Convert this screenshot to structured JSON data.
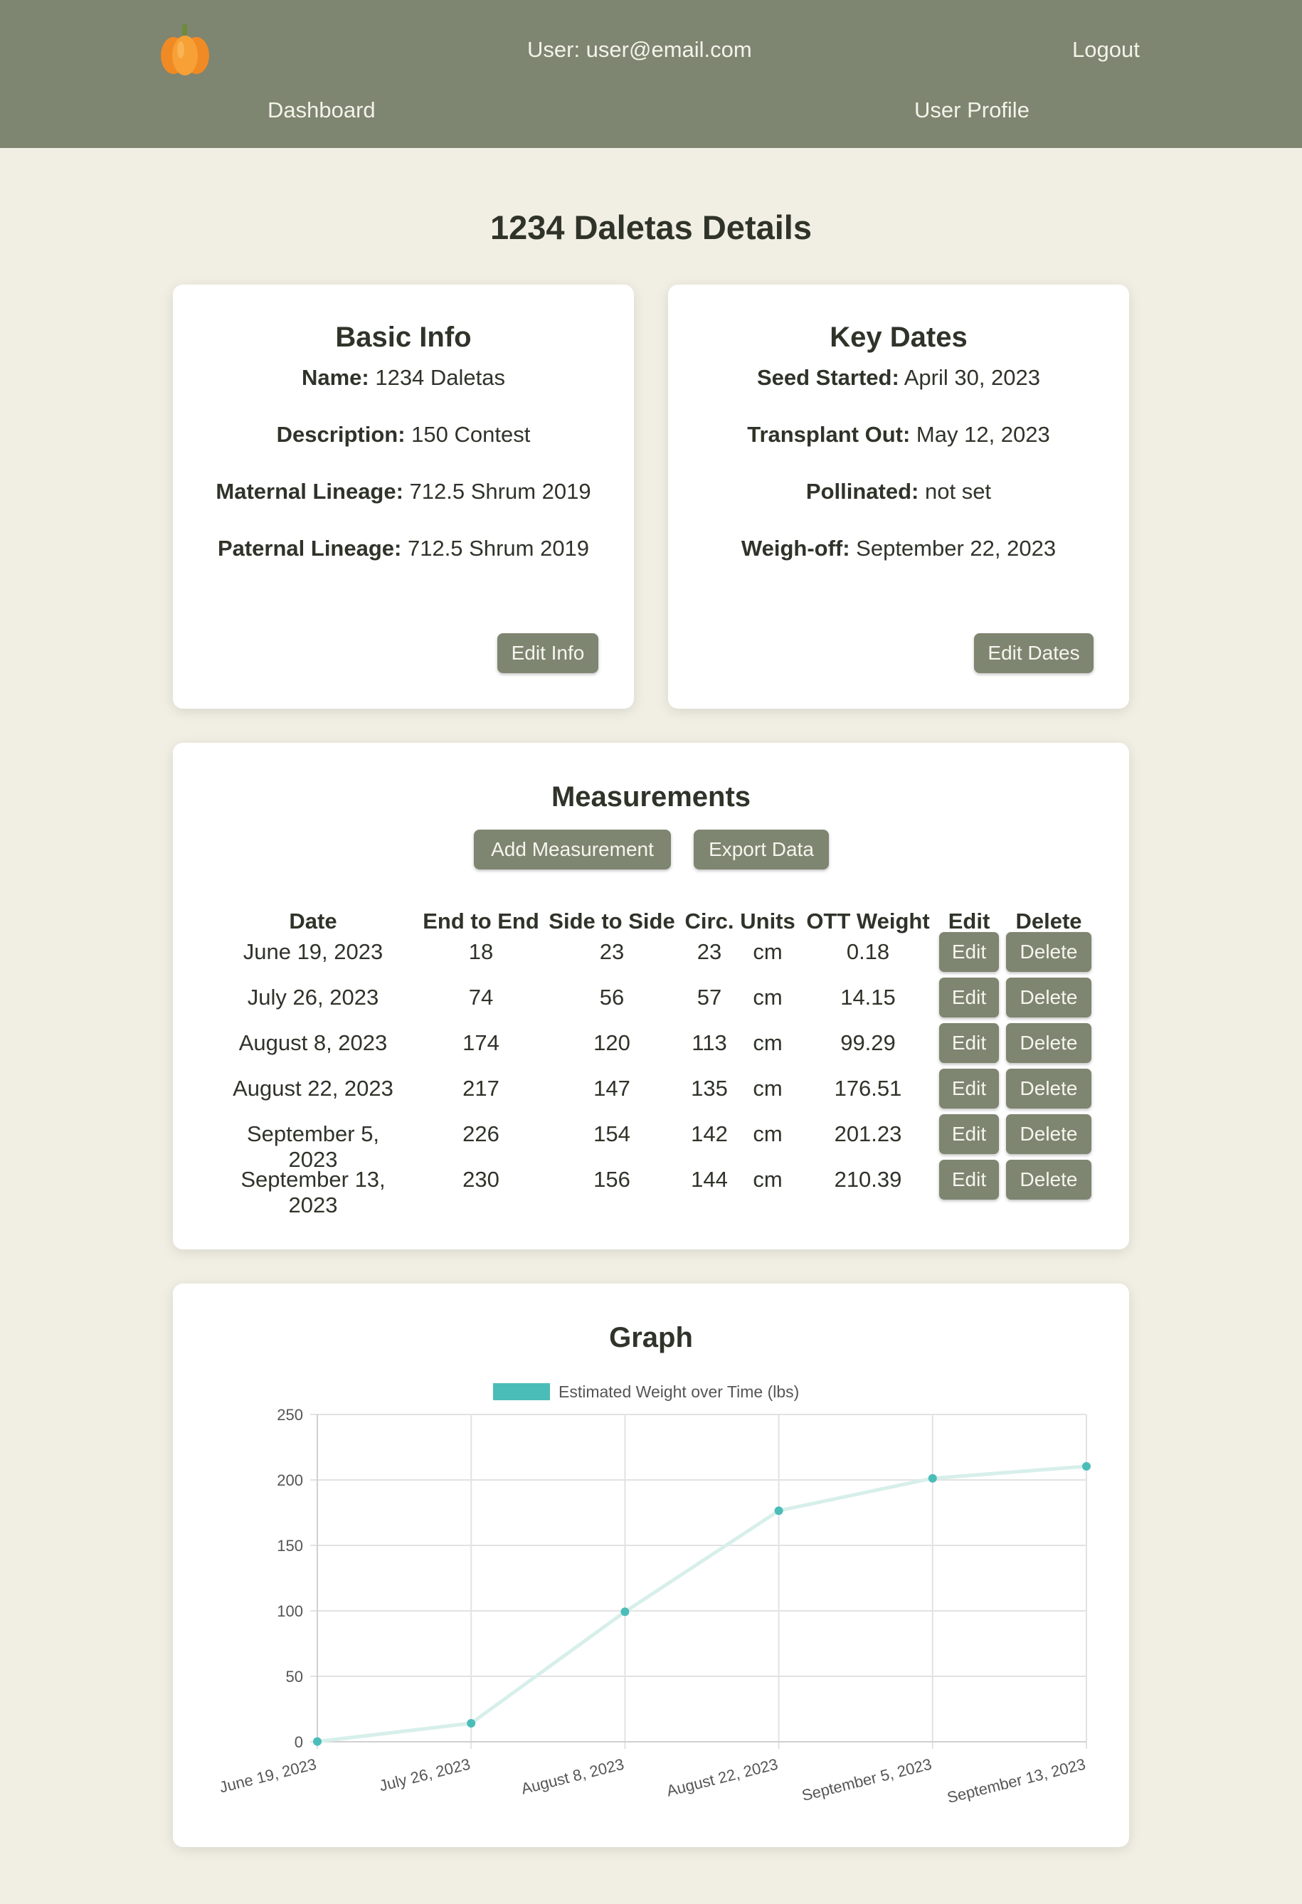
{
  "header": {
    "user_label": "User: user@email.com",
    "logout_label": "Logout",
    "nav": {
      "dashboard": "Dashboard",
      "profile": "User Profile"
    },
    "logo_icon": "pumpkin-icon"
  },
  "page": {
    "title": "1234 Daletas Details"
  },
  "basic_info": {
    "title": "Basic Info",
    "fields": [
      {
        "label": "Name:",
        "value": " 1234 Daletas"
      },
      {
        "label": "Description:",
        "value": " 150 Contest"
      },
      {
        "label": "Maternal Lineage:",
        "value": " 712.5 Shrum 2019"
      },
      {
        "label": "Paternal Lineage:",
        "value": " 712.5 Shrum 2019"
      }
    ],
    "edit_label": "Edit Info"
  },
  "key_dates": {
    "title": "Key Dates",
    "fields": [
      {
        "label": "Seed Started:",
        "value": " April 30, 2023"
      },
      {
        "label": "Transplant Out:",
        "value": " May 12, 2023"
      },
      {
        "label": "Pollinated:",
        "value": " not set"
      },
      {
        "label": "Weigh-off:",
        "value": " September 22, 2023"
      }
    ],
    "edit_label": "Edit Dates"
  },
  "measurements": {
    "title": "Measurements",
    "add_label": "Add Measurement",
    "export_label": "Export Data",
    "columns": [
      "Date",
      "End to End",
      "Side to Side",
      "Circ.",
      "Units",
      "OTT Weight",
      "Edit",
      "Delete"
    ],
    "edit_label": "Edit",
    "delete_label": "Delete",
    "rows": [
      [
        "June 19, 2023",
        "18",
        "23",
        "23",
        "cm",
        "0.18"
      ],
      [
        "July 26, 2023",
        "74",
        "56",
        "57",
        "cm",
        "14.15"
      ],
      [
        "August 8, 2023",
        "174",
        "120",
        "113",
        "cm",
        "99.29"
      ],
      [
        "August 22, 2023",
        "217",
        "147",
        "135",
        "cm",
        "176.51"
      ],
      [
        "September 5, 2023",
        "226",
        "154",
        "142",
        "cm",
        "201.23"
      ],
      [
        "September 13, 2023",
        "230",
        "156",
        "144",
        "cm",
        "210.39"
      ]
    ]
  },
  "graph": {
    "title": "Graph"
  },
  "chart_data": {
    "type": "line",
    "categories": [
      "June 19, 2023",
      "July 26, 2023",
      "August 8, 2023",
      "August 22, 2023",
      "September 5, 2023",
      "September 13, 2023"
    ],
    "series": [
      {
        "name": "Estimated Weight over Time (lbs)",
        "values": [
          0.18,
          14.15,
          99.29,
          176.51,
          201.23,
          210.39
        ]
      }
    ],
    "ylim": [
      0,
      250
    ],
    "yticks": [
      "250",
      "200",
      "150",
      "100",
      "50",
      "0"
    ],
    "grid": true,
    "legend": "top-center",
    "colors": {
      "line": "#d7efea",
      "point": "#4bbdb9",
      "legend_box": "#4bbdb9"
    }
  }
}
